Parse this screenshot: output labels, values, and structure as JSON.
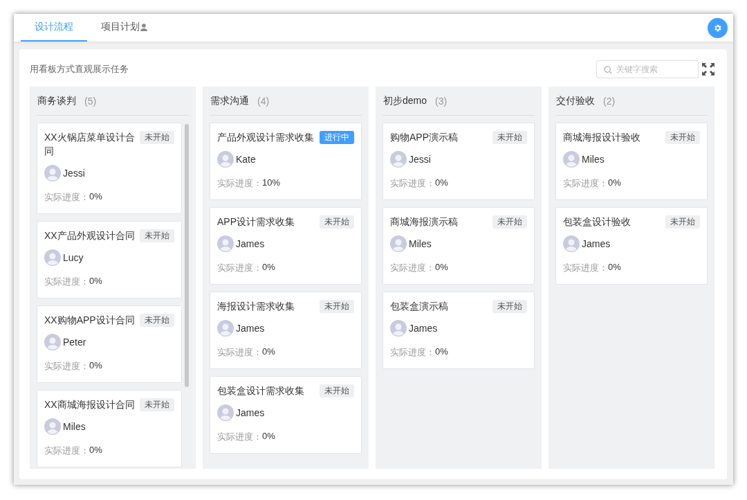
{
  "tabs": [
    {
      "label": "设计流程",
      "selected": true,
      "person_icon": false
    },
    {
      "label": "项目计划",
      "selected": false,
      "person_icon": true
    }
  ],
  "board": {
    "description": "用看板方式直观展示任务",
    "search": {
      "placeholder": "关键字搜索"
    },
    "columns": [
      {
        "title": "商务谈判",
        "count": "(5)",
        "scrollbar": true,
        "cards": [
          {
            "title": "XX火锅店菜单设计合同",
            "status": "未开始",
            "kind": "not_started",
            "assignee": "Jessi",
            "progress_label": "实际进度：",
            "progress": "0%"
          },
          {
            "title": "XX产品外观设计合同",
            "status": "未开始",
            "kind": "not_started",
            "assignee": "Lucy",
            "progress_label": "实际进度：",
            "progress": "0%"
          },
          {
            "title": "XX购物APP设计合同",
            "status": "未开始",
            "kind": "not_started",
            "assignee": "Peter",
            "progress_label": "实际进度：",
            "progress": "0%"
          },
          {
            "title": "XX商城海报设计合同",
            "status": "未开始",
            "kind": "not_started",
            "assignee": "Miles",
            "progress_label": "实际进度：",
            "progress": "0%"
          }
        ]
      },
      {
        "title": "需求沟通",
        "count": "(4)",
        "scrollbar": false,
        "cards": [
          {
            "title": "产品外观设计需求收集",
            "status": "进行中",
            "kind": "in_progress",
            "assignee": "Kate",
            "progress_label": "实际进度：",
            "progress": "10%"
          },
          {
            "title": "APP设计需求收集",
            "status": "未开始",
            "kind": "not_started",
            "assignee": "James",
            "progress_label": "实际进度：",
            "progress": "0%"
          },
          {
            "title": "海报设计需求收集",
            "status": "未开始",
            "kind": "not_started",
            "assignee": "James",
            "progress_label": "实际进度：",
            "progress": "0%"
          },
          {
            "title": "包装盒设计需求收集",
            "status": "未开始",
            "kind": "not_started",
            "assignee": "James",
            "progress_label": "实际进度：",
            "progress": "0%"
          }
        ]
      },
      {
        "title": "初步demo",
        "count": "(3)",
        "scrollbar": false,
        "cards": [
          {
            "title": "购物APP演示稿",
            "status": "未开始",
            "kind": "not_started",
            "assignee": "Jessi",
            "progress_label": "实际进度：",
            "progress": "0%"
          },
          {
            "title": "商城海报演示稿",
            "status": "未开始",
            "kind": "not_started",
            "assignee": "Miles",
            "progress_label": "实际进度：",
            "progress": "0%"
          },
          {
            "title": "包装盒演示稿",
            "status": "未开始",
            "kind": "not_started",
            "assignee": "James",
            "progress_label": "实际进度：",
            "progress": "0%"
          }
        ]
      },
      {
        "title": "交付验收",
        "count": "(2)",
        "scrollbar": false,
        "cards": [
          {
            "title": "商城海报设计验收",
            "status": "未开始",
            "kind": "not_started",
            "assignee": "Miles",
            "progress_label": "实际进度：",
            "progress": "0%"
          },
          {
            "title": "包装盒设计验收",
            "status": "未开始",
            "kind": "not_started",
            "assignee": "James",
            "progress_label": "实际进度：",
            "progress": "0%"
          }
        ]
      }
    ]
  }
}
